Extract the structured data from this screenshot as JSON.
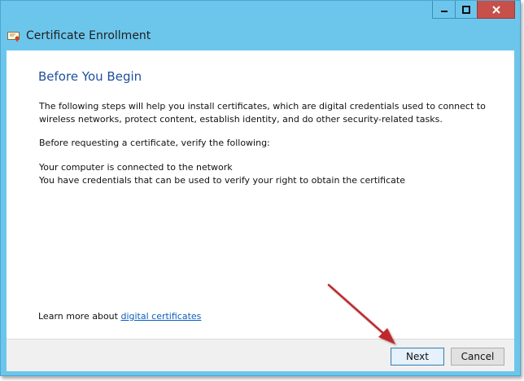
{
  "window": {
    "title": "Certificate Enrollment"
  },
  "content": {
    "heading": "Before You Begin",
    "paragraph1": "The following steps will help you install certificates, which are digital credentials used to connect to wireless networks, protect content, establish identity, and do other security-related tasks.",
    "paragraph2": "Before requesting a certificate, verify the following:",
    "requirements": [
      "Your computer is connected to the network",
      "You have credentials that can be used to verify your right to obtain the certificate"
    ],
    "learn_more_prefix": "Learn more about ",
    "learn_more_link": "digital certificates"
  },
  "buttons": {
    "next": "Next",
    "cancel": "Cancel"
  },
  "icons": {
    "app": "certificate-icon",
    "minimize": "minimize-icon",
    "maximize": "maximize-icon",
    "close": "close-icon",
    "annotation": "red-arrow-icon"
  },
  "colors": {
    "titlebar": "#6cc6ec",
    "close_button": "#c7504a",
    "heading": "#1e4f9c",
    "link": "#0b5fbf",
    "annotation_arrow": "#c0262b"
  }
}
